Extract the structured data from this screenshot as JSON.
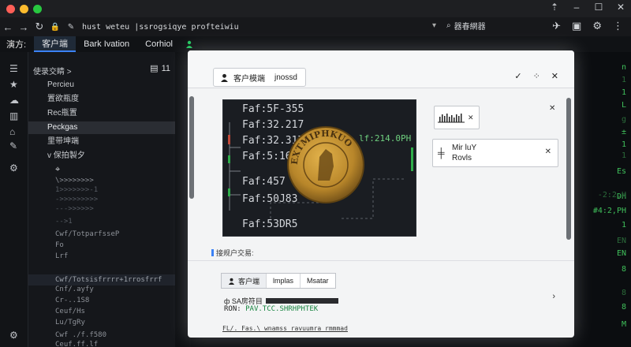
{
  "window": {
    "url": "hust weteu |ssrogsiqye profteiwiu",
    "search_text": "器春網器"
  },
  "tabs": [
    {
      "label": "演方:",
      "active": false
    },
    {
      "label": "客户端",
      "active": true
    },
    {
      "label": "Bark Ivation",
      "active": false
    },
    {
      "label": "Corhiol",
      "active": false
    }
  ],
  "sidebar": {
    "header": "使录交睛 >",
    "badge": "11",
    "items": [
      {
        "label": "Percieu"
      },
      {
        "label": "置欲瓶度"
      },
      {
        "label": "Rec瓶置"
      },
      {
        "label": "Peckgas"
      },
      {
        "label": "里带坤端"
      },
      {
        "label": "v 保拍製夕"
      }
    ],
    "sub_lines": [
      {
        "text": "\\>>>>>>>>",
        "dim": false
      },
      {
        "text": "1>>>>>>>-1",
        "dim": true
      },
      {
        "text": "->>>>>>>>>",
        "dim": true
      },
      {
        "text": "--->>>>>>",
        "dim": true
      },
      {
        "text": "-->1",
        "dim": true
      },
      {
        "text": "Cwf/TotparfsseP",
        "dim": false
      },
      {
        "text": "Fo",
        "dim": false
      },
      {
        "text": "Lrf",
        "dim": false
      },
      {
        "text": "Cnf/.ayfy",
        "dim": false
      },
      {
        "text": "Cr-..1S8",
        "dim": false
      },
      {
        "text": "Ceuf/Hs",
        "dim": false
      },
      {
        "text": "Lu/TgRy",
        "dim": false
      },
      {
        "text": "Cwf ./f.f580",
        "dim": false
      },
      {
        "text": "Ceuf.ff.lf",
        "dim": false
      }
    ],
    "highlight_line": "Cwf/Totsisfrrrr+1rrosfrrf"
  },
  "right_pane": {
    "lines": [
      "n",
      "1",
      "1",
      "L",
      "g",
      "±",
      "1",
      "1",
      "Es",
      "DH",
      "-2:2,H",
      "#4:2,PH",
      "1",
      "EN",
      "EN",
      "8",
      "8",
      "8",
      "M"
    ]
  },
  "dialog": {
    "tab_label": "客户模端",
    "tab_value": "jnossd",
    "image_lines": [
      "Faf:5F-355",
      "Faf:32.217",
      "Faf:32.317",
      "Faf:5:16",
      "Faf:457",
      "Faf:50J83",
      "Faf:53DR5"
    ],
    "image_trail": "lf:214.0PH",
    "coin_text": "EXTMIPHKUO",
    "card1_icon": "chart-icon",
    "card2_line1": "Mir luY",
    "card2_line2": "Rovls",
    "section_label": "接规户交易:",
    "lower_tabs": [
      "客户端",
      "lmplas",
      "Msatar"
    ],
    "row1_label": "ф SA房符目",
    "row2_key": "RON:",
    "row2_value": "PAV.TCC.SHRHPHTEK",
    "row3_text": "FL/. Fas.\\ wnamss ravuumra rmmmad"
  }
}
